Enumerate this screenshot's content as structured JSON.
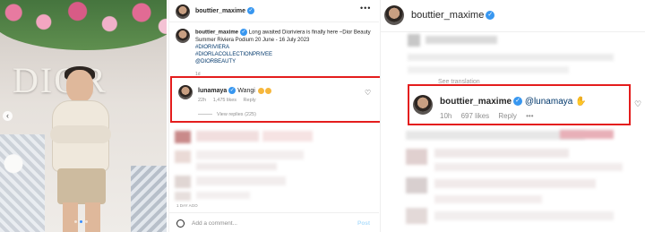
{
  "photo": {
    "brand_text": "DIOR",
    "prev_arrow": "‹",
    "slide_count": 3,
    "active_slide": 2
  },
  "post": {
    "username": "bouttier_maxime",
    "more": "•••",
    "caption": {
      "username": "bouttier_maxime",
      "text": "Long awaited Dioriviera is finally here ~Dior Beauty Summer Riviera Podium 20 June - 16 July 2023",
      "hashtags": [
        "#DIORIVIERA",
        "#DIORLACOLLECTIONPRIVEE",
        "@DIORBEAUTY"
      ],
      "time": "1d"
    },
    "comment": {
      "username": "lunamaya",
      "text": "Wangi",
      "time": "22h",
      "likes": "1,475 likes",
      "reply_label": "Reply",
      "view_replies": "View replies (225)"
    },
    "footer_time": "1 DAY AGO",
    "add_comment_placeholder": "Add a comment...",
    "post_button": "Post"
  },
  "zoom": {
    "username": "bouttier_maxime",
    "see_translation": "See translation",
    "reply": {
      "username": "bouttier_maxime",
      "mention": "@lunamaya",
      "time": "10h",
      "likes": "697 likes",
      "reply_label": "Reply",
      "more": "•••"
    }
  },
  "colors": {
    "highlight_border": "#e41d1d",
    "verified_blue": "#3897f0",
    "link_blue": "#00376b",
    "meta_gray": "#8e8e8e"
  },
  "icons": {
    "verified": "verified-badge-icon",
    "heart": "heart-icon",
    "emoji": "smiley-icon",
    "more": "more-options-icon",
    "hand": "waving-hand-icon"
  }
}
